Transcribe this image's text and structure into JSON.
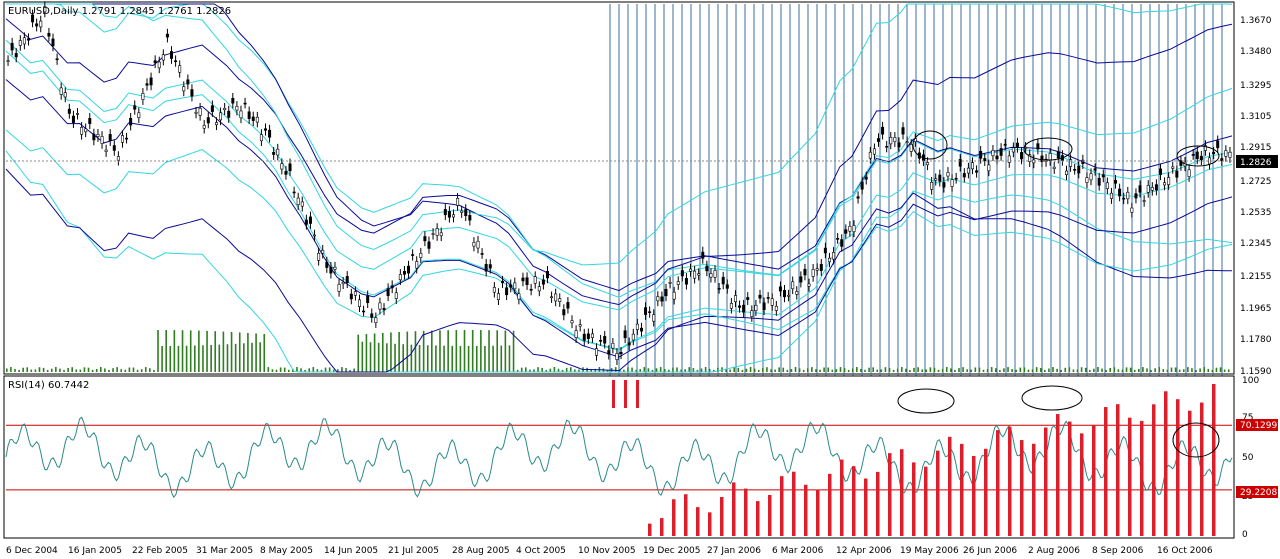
{
  "header": {
    "price_header": "EURUSD,Daily  1.2791  1.2845  1.2761  1.2826",
    "rsi_header": "RSI(14)  60.7442"
  },
  "price_axis": {
    "ticks": [
      "1.3670",
      "1.3480",
      "1.3295",
      "1.3105",
      "1.2915",
      "1.2725",
      "1.2535",
      "1.2345",
      "1.2155",
      "1.1965",
      "1.1780",
      "1.1590"
    ],
    "current_label": "1.2826"
  },
  "rsi_axis": {
    "ticks": [
      "100",
      "75",
      "50",
      "25",
      "0"
    ],
    "upper_level_label": "70.1299",
    "lower_level_label": "29.2208"
  },
  "time_axis": {
    "labels": [
      "6 Dec 2004",
      "16 Jan 2005",
      "22 Feb 2005",
      "31 Mar 2005",
      "8 May 2005",
      "14 Jun 2005",
      "21 Jul 2005",
      "28 Aug 2005",
      "4 Oct 2005",
      "10 Nov 2005",
      "19 Dec 2005",
      "27 Jan 2006",
      "6 Mar 2006",
      "12 Apr 2006",
      "19 May 2006",
      "26 Jun 2006",
      "2 Aug 2006",
      "8 Sep 2006",
      "16 Oct 2006"
    ]
  },
  "colors": {
    "candle": "#000000",
    "envelope_dark": "#0a0a96",
    "envelope_light": "#33d6e0",
    "volume": "#2e7d1f",
    "vlines": "#3c6e9e",
    "rsi_line": "#2a8a8a",
    "rsi_levels": "#cc0000",
    "rsi_hist": "#dd1e2a",
    "current_label_bg": "#000000",
    "level_label_bg": "#cc0000"
  }
}
